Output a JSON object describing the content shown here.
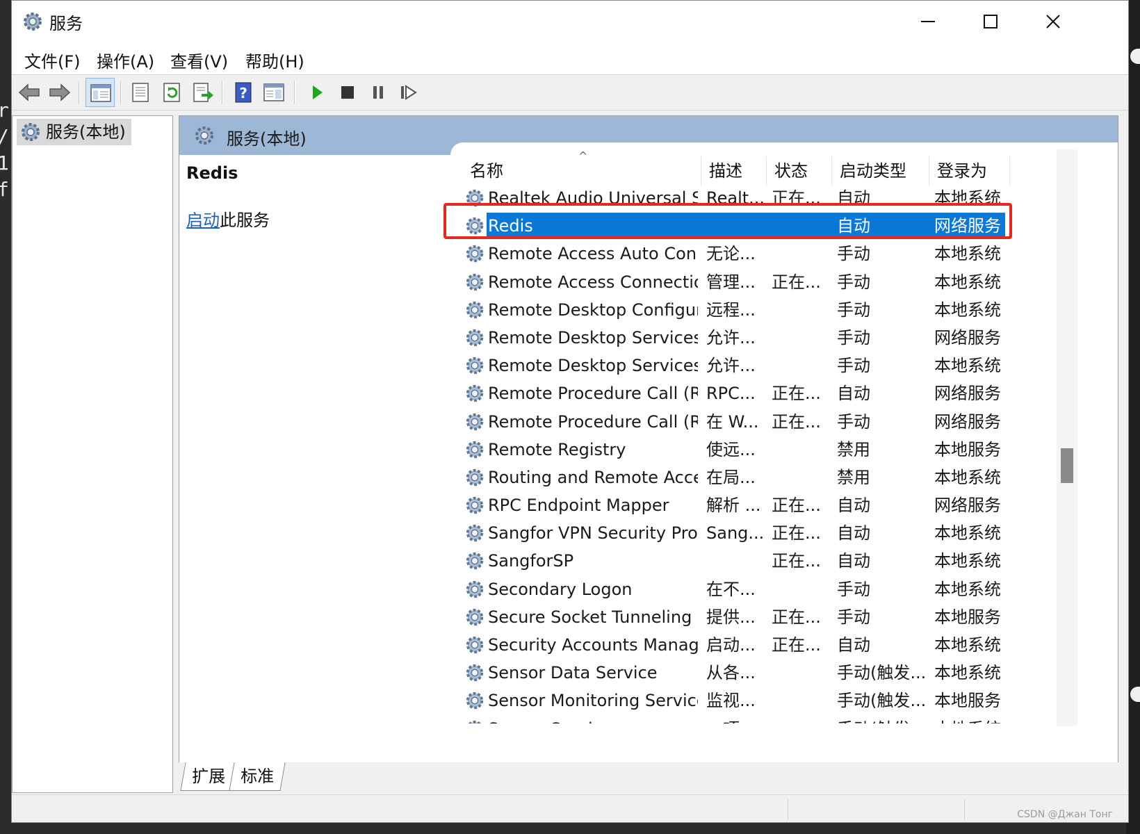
{
  "window": {
    "title": "服务"
  },
  "menu": [
    "文件(F)",
    "操作(A)",
    "查看(V)",
    "帮助(H)"
  ],
  "bg_chars": [
    "r",
    "/",
    "1",
    "f"
  ],
  "tree": {
    "root_label": "服务(本地)"
  },
  "header": {
    "title": "服务(本地)"
  },
  "detail": {
    "name": "Redis",
    "link_text": "启动",
    "link_suffix": "此服务"
  },
  "columns": {
    "name": "名称",
    "desc": "描述",
    "status": "状态",
    "startup": "启动类型",
    "logon": "登录为"
  },
  "services": [
    {
      "name": "Realtek Audio Universal Se...",
      "desc": "Realt...",
      "status": "正在...",
      "startup": "自动",
      "logon": "本地系统"
    },
    {
      "name": "Redis",
      "desc": "",
      "status": "",
      "startup": "自动",
      "logon": "网络服务",
      "selected": true
    },
    {
      "name": "Remote Access Auto Conn...",
      "desc": "无论...",
      "status": "",
      "startup": "手动",
      "logon": "本地系统"
    },
    {
      "name": "Remote Access Connectio...",
      "desc": "管理...",
      "status": "正在...",
      "startup": "手动",
      "logon": "本地系统"
    },
    {
      "name": "Remote Desktop Configur...",
      "desc": "远程...",
      "status": "",
      "startup": "手动",
      "logon": "本地系统"
    },
    {
      "name": "Remote Desktop Services",
      "desc": "允许...",
      "status": "",
      "startup": "手动",
      "logon": "网络服务"
    },
    {
      "name": "Remote Desktop Services ...",
      "desc": "允许...",
      "status": "",
      "startup": "手动",
      "logon": "本地系统"
    },
    {
      "name": "Remote Procedure Call (R...",
      "desc": "RPC...",
      "status": "正在...",
      "startup": "自动",
      "logon": "网络服务"
    },
    {
      "name": "Remote Procedure Call (R...",
      "desc": "在 W...",
      "status": "正在...",
      "startup": "手动",
      "logon": "网络服务"
    },
    {
      "name": "Remote Registry",
      "desc": "使远...",
      "status": "",
      "startup": "禁用",
      "logon": "本地服务"
    },
    {
      "name": "Routing and Remote Access",
      "desc": "在局...",
      "status": "",
      "startup": "禁用",
      "logon": "本地系统"
    },
    {
      "name": "RPC Endpoint Mapper",
      "desc": "解析 ...",
      "status": "正在...",
      "startup": "自动",
      "logon": "网络服务"
    },
    {
      "name": "Sangfor VPN Security Prot...",
      "desc": "Sang...",
      "status": "正在...",
      "startup": "自动",
      "logon": "本地系统"
    },
    {
      "name": "SangforSP",
      "desc": "",
      "status": "正在...",
      "startup": "自动",
      "logon": "本地系统"
    },
    {
      "name": "Secondary Logon",
      "desc": "在不...",
      "status": "",
      "startup": "手动",
      "logon": "本地系统"
    },
    {
      "name": "Secure Socket Tunneling P...",
      "desc": "提供...",
      "status": "正在...",
      "startup": "手动",
      "logon": "本地服务"
    },
    {
      "name": "Security Accounts Manager",
      "desc": "启动...",
      "status": "正在...",
      "startup": "自动",
      "logon": "本地系统"
    },
    {
      "name": "Sensor Data Service",
      "desc": "从各...",
      "status": "",
      "startup": "手动(触发...",
      "logon": "本地系统"
    },
    {
      "name": "Sensor Monitoring Service",
      "desc": "监视...",
      "status": "",
      "startup": "手动(触发...",
      "logon": "本地服务"
    },
    {
      "name": "Sensor Service",
      "desc": "一项...",
      "status": "",
      "startup": "手动(触发...",
      "logon": "本地系统"
    }
  ],
  "tabs": [
    "扩展",
    "标准"
  ],
  "watermark": "CSDN @Джан Тонг",
  "colors": {
    "selection": "#0a78d7",
    "highlight_border": "#e8281e",
    "header_band": "#9db7d6",
    "link": "#1f5fbf"
  },
  "icons": [
    "gear-icon",
    "back-icon",
    "forward-icon",
    "console-tree-icon",
    "properties-icon",
    "refresh-icon",
    "export-icon",
    "help-icon",
    "view-icon",
    "play-icon",
    "stop-icon",
    "pause-icon",
    "restart-icon"
  ]
}
